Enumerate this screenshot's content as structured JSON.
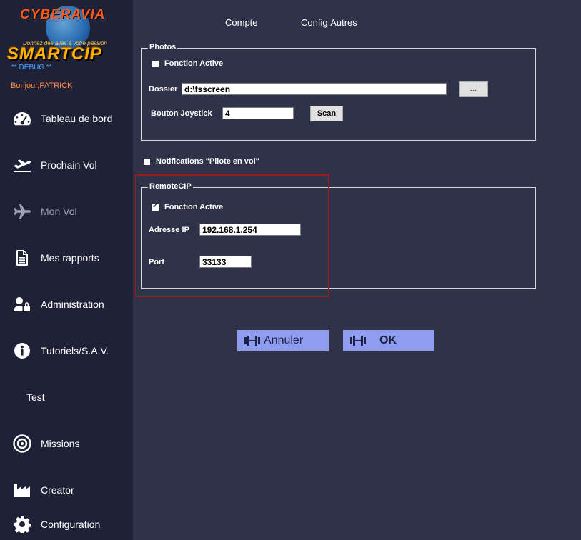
{
  "sidebar": {
    "logo": {
      "top_text": "CYBERAVIA",
      "slogan": "Donnez des ailes à votre passion",
      "main_text": "SMARTCIP"
    },
    "debug_label": "** DEBUG **",
    "greeting": "Bonjour,PATRICK",
    "items": [
      {
        "label": "Tableau de bord",
        "icon": "dashboard-icon"
      },
      {
        "label": "Prochain Vol",
        "icon": "plane-departure-icon"
      },
      {
        "label": "Mon Vol",
        "icon": "plane-icon"
      },
      {
        "label": "Mes rapports",
        "icon": "document-icon"
      },
      {
        "label": "Administration",
        "icon": "user-lock-icon"
      },
      {
        "label": "Tutoriels/S.A.V.",
        "icon": "info-icon"
      },
      {
        "label": "Test",
        "icon": ""
      },
      {
        "label": "Missions",
        "icon": "target-icon"
      },
      {
        "label": "Creator",
        "icon": "factory-icon"
      },
      {
        "label": "Configuration",
        "icon": "gear-icon"
      }
    ]
  },
  "tabs": [
    "Compte",
    "Config.Autres"
  ],
  "photos": {
    "title": "Photos",
    "active_label": "Fonction Active",
    "active_checked": false,
    "folder_label": "Dossier",
    "folder_value": "d:\\fsscreen",
    "browse_label": "...",
    "joystick_label": "Bouton Joystick",
    "joystick_value": "4",
    "scan_label": "Scan"
  },
  "notifications": {
    "label": "Notifications \"Pilote en vol\"",
    "checked": false
  },
  "remote": {
    "title": "RemoteCIP",
    "active_label": "Fonction Active",
    "active_checked": true,
    "ip_label": "Adresse IP",
    "ip_value": "192.168.1.254",
    "port_label": "Port",
    "port_value": "33133"
  },
  "actions": {
    "cancel_label": "Annuler",
    "ok_label": "OK"
  },
  "colors": {
    "sidebar_bg": "#1f2237",
    "main_bg": "#2f3248",
    "button_bg": "#8f9df0",
    "highlight": "#9a1a22"
  }
}
